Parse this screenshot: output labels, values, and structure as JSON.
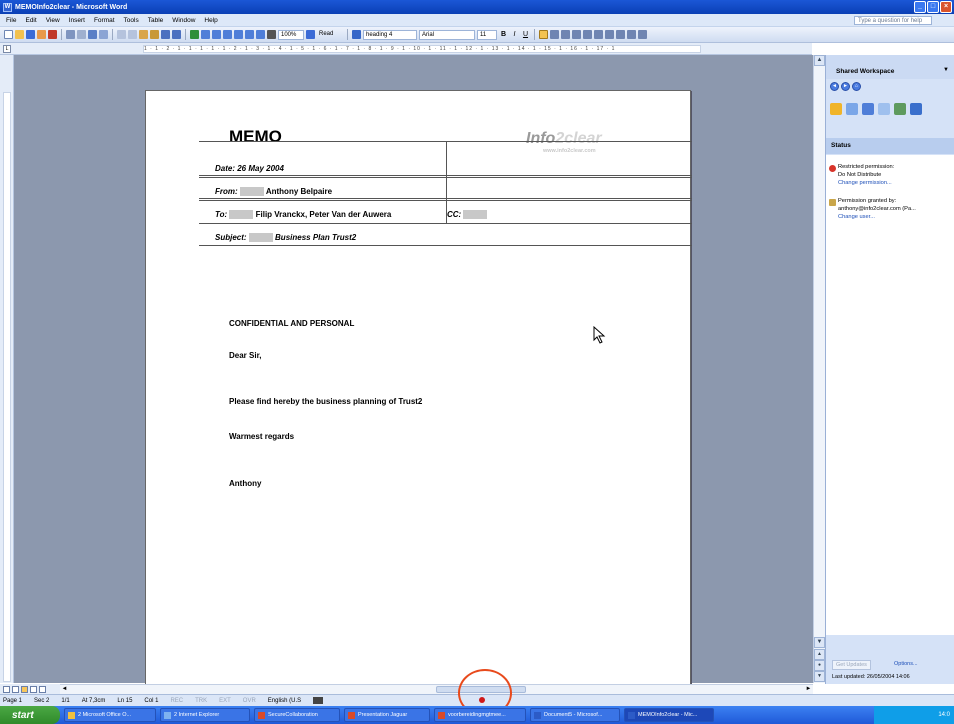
{
  "window": {
    "title": "MEMOInfo2clear - Microsoft Word"
  },
  "menu": {
    "items": [
      "File",
      "Edit",
      "View",
      "Insert",
      "Format",
      "Tools",
      "Table",
      "Window",
      "Help"
    ],
    "help_placeholder": "Type a question for help"
  },
  "toolbar": {
    "zoom": "100%",
    "read_label": "Read",
    "style": "heading 4",
    "font": "Arial",
    "size": "11"
  },
  "ruler": {
    "marks": "1 · 1 · 2 · 1 · 1 · 1 · 1 · 1 · 2 · 1 · 3 · 1 · 4 · 1 · 5 · 1 · 6 · 1 · 7 · 1 · 8 · 1 · 9 · 1 · 10 · 1 · 11 · 1 · 12 · 1 · 13 · 1 · 14 · 1 · 15 · 1 · 16 · 1 · 17 · 1"
  },
  "document": {
    "title": "MEMO",
    "logo": {
      "brand_a": "Info",
      "brand_b": "2clear",
      "url": "www.info2clear.com"
    },
    "date": "Date: 26 May 2004",
    "from_label": "From:",
    "from_value": "Anthony Belpaire",
    "to_label": "To:",
    "to_value": "Filip Vranckx, Peter Van der Auwera",
    "cc_label": "CC:",
    "subject_label": "Subject:",
    "subject_value": "Business Plan Trust2",
    "body": {
      "confidential": "CONFIDENTIAL AND PERSONAL",
      "greeting": "Dear Sir,",
      "line1": "Please find hereby the business planning of Trust2",
      "closing": "Warmest regards",
      "signature": "Anthony"
    }
  },
  "task_pane": {
    "title": "Shared Workspace",
    "status_header": "Status",
    "items": [
      {
        "title": "Restricted permission:",
        "detail": "Do Not Distribute",
        "link": "Change permission..."
      },
      {
        "title": "Permission granted by:",
        "detail": "anthony@info2clear.com (Pa...",
        "link": "Change user..."
      }
    ],
    "get_updates": "Get Updates",
    "options": "Options...",
    "last_updated": "Last updated: 26/05/2004 14:06"
  },
  "status_bar": {
    "page": "Page 1",
    "sec": "Sec 2",
    "pages": "1/1",
    "at": "At 7,3cm",
    "ln": "Ln 15",
    "col": "Col 1",
    "rec": "REC",
    "trk": "TRK",
    "ext": "EXT",
    "ovr": "OVR",
    "lang": "English (U.S"
  },
  "taskbar": {
    "start": "start",
    "tasks": [
      "2 Microsoft Office O...",
      "2 Internet Explorer",
      "SecureCollaboration",
      "Presentation Jaguar",
      "voorbereidingmgtmee...",
      "Document5 - Microsof...",
      "MEMOInfo2clear - Mic..."
    ],
    "tray_time": "14:0"
  },
  "colors": {
    "accent": "#0a3fb5",
    "doc_bg": "#8c98ae",
    "annotation_circle": "#e84a1c"
  }
}
